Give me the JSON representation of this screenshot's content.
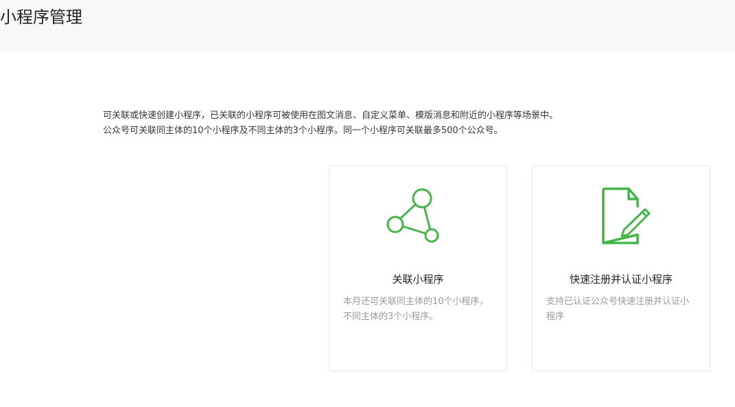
{
  "header": {
    "title": "小程序管理"
  },
  "intro": {
    "line1": "可关联或快速创建小程序，已关联的小程序可被使用在图文消息、自定义菜单、模版消息和附近的小程序等场景中。",
    "line2": "公众号可关联同主体的10个小程序及不同主体的3个小程序。同一个小程序可关联最多500个公众号。"
  },
  "cards": [
    {
      "icon": "link-network-icon",
      "title": "关联小程序",
      "description": "本月还可关联同主体的10个小程序，不同主体的3个小程序。"
    },
    {
      "icon": "document-edit-icon",
      "title": "快速注册并认证小程序",
      "description": "支持已认证公众号快速注册并认证小程序"
    }
  ],
  "colors": {
    "accent": "#44b549",
    "header_bg": "#f6f8f9",
    "muted_text": "#9a9a9a"
  }
}
